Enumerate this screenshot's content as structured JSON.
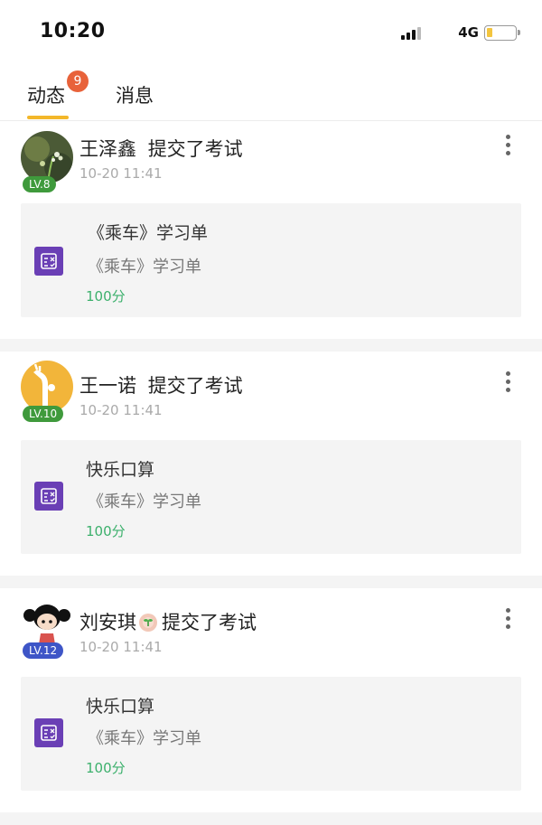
{
  "status_bar": {
    "time": "10:20",
    "network": "4G",
    "battery_level": 0.15,
    "battery_color": "#f3c53f"
  },
  "tabs": {
    "active": "动态",
    "badge": "9",
    "messages": "消息",
    "accent_color": "#f3b72a",
    "badge_color": "#e8623a"
  },
  "posts": [
    {
      "user": "王泽鑫",
      "action": "提交了考试",
      "time": "10-20 11:41",
      "level": "LV.8",
      "level_color": "#3f9a3c",
      "avatar_icon": "flower-photo-avatar",
      "card": {
        "title": "《乘车》学习单",
        "subtitle": "《乘车》学习单",
        "score": "100分"
      }
    },
    {
      "user": "王一诺",
      "action": "提交了考试",
      "time": "10-20 11:41",
      "level": "LV.10",
      "level_color": "#3f9a3c",
      "avatar_icon": "giraffe-avatar",
      "card": {
        "title": "快乐口算",
        "subtitle": "《乘车》学习单",
        "score": "100分"
      }
    },
    {
      "user": "刘安琪",
      "action": "提交了考试",
      "time": "10-20 11:41",
      "level": "LV.12",
      "level_color": "#3e55c7",
      "avatar_icon": "cartoon-girl-avatar",
      "name_icon": "sprout-flower-icon",
      "card": {
        "title": "快乐口算",
        "subtitle": "《乘车》学习单",
        "score": "100分"
      }
    }
  ],
  "colors": {
    "card_bg": "#f4f4f4",
    "doc_icon": "#6a3fb5",
    "score_text": "#3cb06c",
    "divider": "#f4f4f4"
  }
}
